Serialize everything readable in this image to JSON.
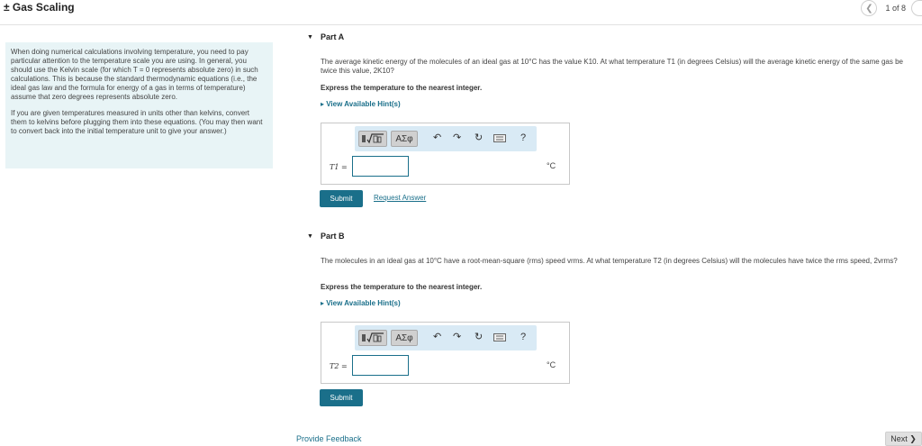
{
  "header": {
    "title": "± Gas Scaling",
    "pager": "1 of 8"
  },
  "intro": {
    "p1": "When doing numerical calculations involving temperature, you need to pay particular attention to the temperature scale you are using. In general, you should use the Kelvin scale (for which T = 0 represents absolute zero) in such calculations. This is because the standard thermodynamic equations (i.e., the ideal gas law and the formula for energy of a gas in terms of temperature) assume that zero degrees represents absolute zero.",
    "p2": "If you are given temperatures measured in units other than kelvins, convert them to kelvins before plugging them into these equations. (You may then want to convert back into the initial temperature unit to give your answer.)"
  },
  "partA": {
    "label": "Part A",
    "question": "The average kinetic energy of the molecules of an ideal gas at 10°C has the value K10. At what temperature T1 (in degrees Celsius) will the average kinetic energy of the same gas be twice this value, 2K10?",
    "instruction": "Express the temperature to the nearest integer.",
    "hint": "▸ View Available Hint(s)",
    "var": "T1 =",
    "unit": "°C",
    "input_value": "",
    "submit": "Submit",
    "request": "Request Answer"
  },
  "partB": {
    "label": "Part B",
    "question": "The molecules in an ideal gas at 10°C have a root-mean-square (rms) speed vrms. At what temperature T2 (in degrees Celsius) will the molecules have twice the rms speed, 2vrms?",
    "instruction": "Express the temperature to the nearest integer.",
    "hint": "▸ View Available Hint(s)",
    "var": "T2 =",
    "unit": "°C",
    "input_value": "",
    "submit": "Submit"
  },
  "toolbar": {
    "template_icon": "fraction-sqrt-template-icon",
    "symbols_label": "ΑΣφ",
    "undo_icon": "undo-arrow-icon",
    "redo_icon": "redo-arrow-icon",
    "reset_icon": "reset-circle-icon",
    "keyboard_icon": "keyboard-icon",
    "help_label": "?"
  },
  "footer": {
    "feedback": "Provide Feedback",
    "next": "Next ❯"
  },
  "colors": {
    "accent": "#1a6f8a",
    "intro_bg": "#e8f4f6",
    "toolbar_bg": "#d9eaf5"
  }
}
